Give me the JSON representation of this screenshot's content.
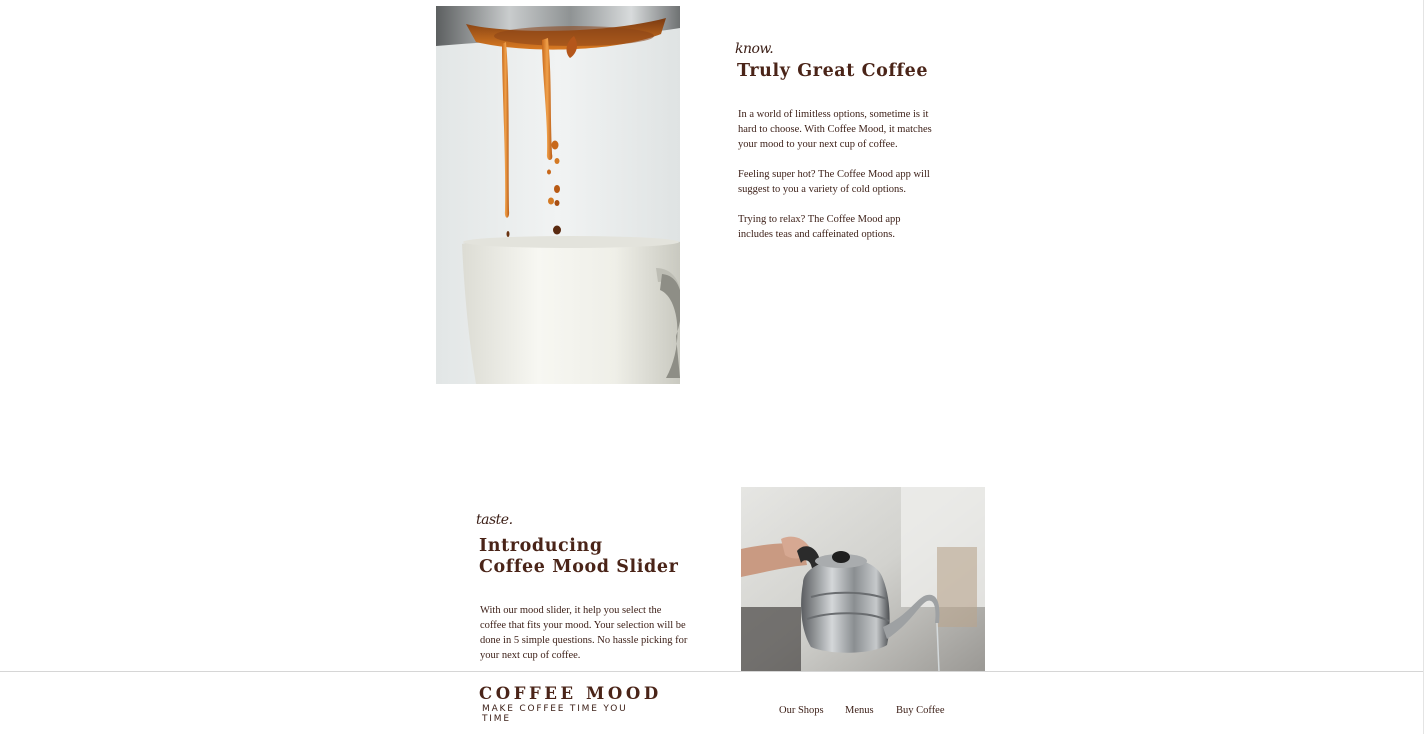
{
  "intro": {
    "kicker": "know.",
    "heading": "Truly Great Coffee",
    "paragraphs": [
      "In a world of limitless options, sometime is it hard to choose. With Coffee Mood, it matches your mood to your next cup of coffee.",
      "Feeling super hot? The Coffee Mood app will suggest to you a variety of cold options.",
      "Trying to relax? The Coffee Mood app includes teas and caffeinated options."
    ]
  },
  "slider": {
    "kicker": "taste.",
    "heading_line1": "Introducing",
    "heading_line2": "Coffee Mood Slider",
    "paragraph": "With our mood slider, it help you select the coffee that fits your mood. Your selection will be done in 5 simple questions. No hassle picking for your next cup of coffee."
  },
  "footer": {
    "brand": "COFFEE MOOD",
    "tagline": "MAKE COFFEE TIME YOU TIME",
    "nav": [
      "Our Shops",
      "Menus",
      "Buy Coffee"
    ]
  }
}
